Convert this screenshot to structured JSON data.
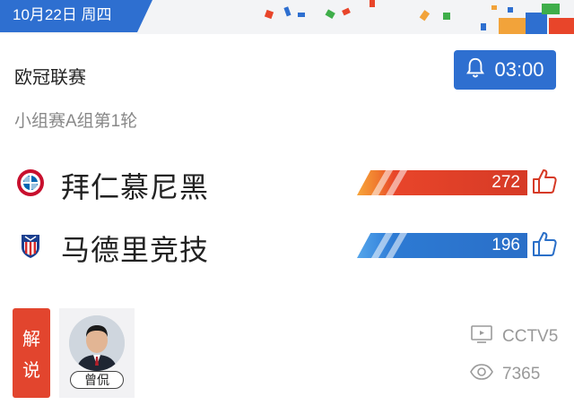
{
  "header": {
    "date": "10月22日 周四"
  },
  "match": {
    "league": "欧冠联赛",
    "stage": "小组赛A组第1轮",
    "time_button": {
      "icon": "bell-icon",
      "time": "03:00"
    }
  },
  "teams": [
    {
      "name": "拜仁慕尼黑",
      "votes": "272",
      "logo": "bayern-logo-icon",
      "bar_color": "#d63a26"
    },
    {
      "name": "马德里竞技",
      "votes": "196",
      "logo": "atletico-logo-icon",
      "bar_color": "#2a6fc8"
    }
  ],
  "commentary": {
    "badge": "解说",
    "badge_chars": [
      "解",
      "说"
    ],
    "commentator_name": "曾侃"
  },
  "broadcast": {
    "channel": "CCTV5",
    "views": "7365",
    "channel_icon": "tv-icon",
    "views_icon": "eye-icon"
  },
  "colors": {
    "accent_blue": "#2e6fd0",
    "accent_red": "#e2452e"
  }
}
